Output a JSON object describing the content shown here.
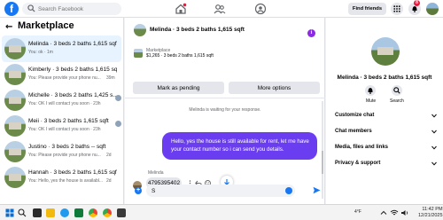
{
  "colors": {
    "facebook_blue": "#1877f2",
    "message_purple": "#6b3df0",
    "notification_red": "#e41e3f",
    "active_item_bg": "#e7f3ff"
  },
  "topbar": {
    "logo_letter": "f",
    "search_placeholder": "Search Facebook",
    "find_friends_label": "Find friends",
    "notification_count": "8"
  },
  "left": {
    "title": "Marketplace",
    "chats": [
      {
        "name": "Melinda · 3 beds 2 baths 1,615 sqft",
        "last": "You: ok · 1m",
        "time": ""
      },
      {
        "name": "Kimberly · 3 beds 2 baths 1,615 sqft",
        "last": "You: Please provide your phone nu...",
        "time": "39m"
      },
      {
        "name": "Michelle · 3 beds 2 baths 1,425 s...",
        "last": "You: OK I will contact you soon · 23h",
        "time": ""
      },
      {
        "name": "Meii · 3 beds 2 baths 1,615 sqft",
        "last": "You: OK I will contact you soon · 23h",
        "time": ""
      },
      {
        "name": "Justino · 3 beds 2 baths -- sqft",
        "last": "You: Please provide your phone nu...",
        "time": "2d"
      },
      {
        "name": "Hannah · 3 beds 2 baths 1,615 sqft",
        "last": "You: Hello, yes the house is availabl...",
        "time": "2d"
      }
    ]
  },
  "chat": {
    "header_title": "Melinda · 3 beds 2 baths 1,615 sqft",
    "marketplace_label": "Marketplace",
    "listing_line": "$1,265 · 3 beds 2 baths 1,615 sqft",
    "mark_pending_label": "Mark as pending",
    "more_options_label": "More options",
    "waiting_text": "Melinda is waiting for your response.",
    "outgoing_message": "Hello, yes the house is still available for rent, let me have your contact number so i can send you details.",
    "incoming_sender": "Melinda",
    "incoming_message": "4795395402",
    "composer_value": "S"
  },
  "right": {
    "name": "Melinda · 3 beds 2 baths 1,615 sqft",
    "mute_label": "Mute",
    "search_label": "Search",
    "rows": [
      "Customize chat",
      "Chat members",
      "Media, files and links",
      "Privacy & support"
    ]
  },
  "taskbar": {
    "weather": "4°F",
    "time": "11:42 PM",
    "date": "12/21/2025"
  }
}
